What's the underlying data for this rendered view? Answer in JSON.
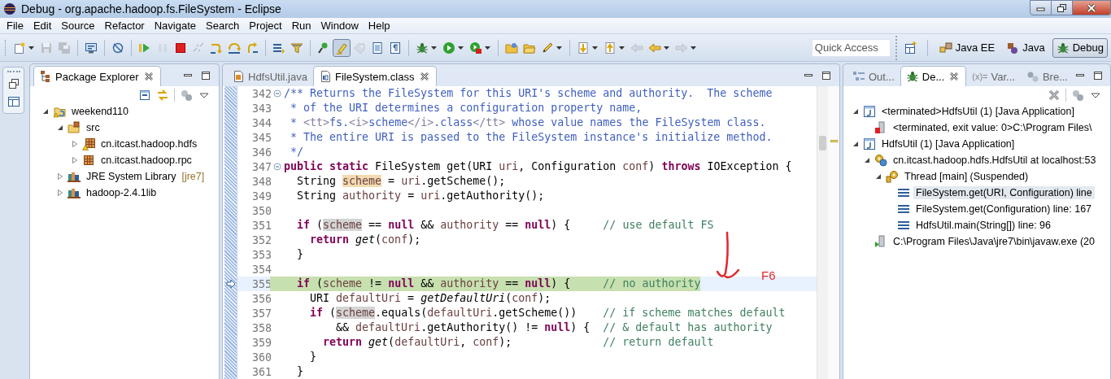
{
  "window": {
    "title": "Debug - org.apache.hadoop.fs.FileSystem - Eclipse"
  },
  "menu": [
    "File",
    "Edit",
    "Source",
    "Refactor",
    "Navigate",
    "Search",
    "Project",
    "Run",
    "Window",
    "Help"
  ],
  "toolbar": [
    [
      {
        "kind": "new",
        "dropdown": true,
        "disabled": false,
        "pressed": false
      },
      {
        "kind": "save",
        "dropdown": false,
        "disabled": true,
        "pressed": false
      },
      {
        "kind": "save-all",
        "dropdown": false,
        "disabled": true,
        "pressed": false
      }
    ],
    [
      {
        "kind": "monitor",
        "dropdown": false,
        "disabled": false,
        "pressed": false
      }
    ],
    [
      {
        "kind": "skip",
        "dropdown": false,
        "disabled": false,
        "pressed": false
      }
    ],
    [
      {
        "kind": "resume",
        "dropdown": false,
        "disabled": false,
        "pressed": false
      },
      {
        "kind": "suspend",
        "dropdown": false,
        "disabled": true,
        "pressed": false
      },
      {
        "kind": "terminate",
        "dropdown": false,
        "disabled": false,
        "pressed": false
      },
      {
        "kind": "disconnect",
        "dropdown": false,
        "disabled": true,
        "pressed": false
      },
      {
        "kind": "step-into",
        "dropdown": false,
        "disabled": false,
        "pressed": false
      },
      {
        "kind": "step-over",
        "dropdown": false,
        "disabled": false,
        "pressed": false
      },
      {
        "kind": "step-return",
        "dropdown": false,
        "disabled": false,
        "pressed": false
      }
    ],
    [
      {
        "kind": "frames",
        "dropdown": false,
        "disabled": false,
        "pressed": false
      },
      {
        "kind": "filter",
        "dropdown": false,
        "disabled": false,
        "pressed": false
      }
    ],
    [
      {
        "kind": "pin",
        "dropdown": false,
        "disabled": false,
        "pressed": false
      },
      {
        "kind": "highlighter",
        "dropdown": false,
        "disabled": false,
        "pressed": true
      },
      {
        "kind": "tag",
        "dropdown": false,
        "disabled": true,
        "pressed": false
      },
      {
        "kind": "block",
        "dropdown": false,
        "disabled": false,
        "pressed": false
      },
      {
        "kind": "pilcrow",
        "dropdown": false,
        "disabled": false,
        "pressed": false
      }
    ],
    [
      {
        "kind": "debug",
        "dropdown": true,
        "disabled": false,
        "pressed": false
      },
      {
        "kind": "run",
        "dropdown": true,
        "disabled": false,
        "pressed": false
      },
      {
        "kind": "external",
        "dropdown": true,
        "disabled": false,
        "pressed": false
      }
    ],
    [
      {
        "kind": "folder-gear",
        "dropdown": false,
        "disabled": false,
        "pressed": false
      },
      {
        "kind": "folder",
        "dropdown": false,
        "disabled": false,
        "pressed": false
      },
      {
        "kind": "pencil",
        "dropdown": true,
        "disabled": false,
        "pressed": false
      }
    ],
    [
      {
        "kind": "down-annotation",
        "dropdown": true,
        "disabled": false,
        "pressed": false
      },
      {
        "kind": "up-annotation",
        "dropdown": true,
        "disabled": false,
        "pressed": false
      },
      {
        "kind": "back",
        "dropdown": false,
        "disabled": true,
        "pressed": false
      },
      {
        "kind": "back",
        "dropdown": true,
        "disabled": false,
        "pressed": false
      },
      {
        "kind": "forward",
        "dropdown": true,
        "disabled": true,
        "pressed": false
      }
    ]
  ],
  "quick_access": {
    "placeholder": "Quick Access"
  },
  "perspectives": [
    {
      "label": "Java EE",
      "kind": "javaee",
      "selected": false
    },
    {
      "label": "Java",
      "kind": "java",
      "selected": false
    },
    {
      "label": "Debug",
      "kind": "debug",
      "selected": true
    }
  ],
  "package_explorer": {
    "tabs": [
      {
        "label": "Package Explorer",
        "kind": "package-explorer",
        "selected": true,
        "closable": true
      }
    ],
    "tree": [
      {
        "label": "weekend110",
        "kind": "project",
        "expandable": true,
        "expanded": true,
        "children": [
          {
            "label": "src",
            "kind": "srcfolder",
            "expandable": true,
            "expanded": true,
            "children": [
              {
                "label": "cn.itcast.hadoop.hdfs",
                "kind": "package-warn",
                "expandable": true,
                "expanded": false
              },
              {
                "label": "cn.itcast.hadoop.rpc",
                "kind": "package",
                "expandable": true,
                "expanded": false
              }
            ]
          },
          {
            "label": "JRE System Library",
            "suffix": "[jre7]",
            "kind": "library",
            "expandable": true,
            "expanded": false
          },
          {
            "label": "hadoop-2.4.1lib",
            "kind": "library",
            "expandable": true,
            "expanded": false
          }
        ]
      }
    ]
  },
  "editor": {
    "tabs": [
      {
        "label": "HdfsUtil.java",
        "kind": "java-file",
        "selected": false,
        "closable": false
      },
      {
        "label": "FileSystem.class",
        "kind": "class-file",
        "selected": true,
        "closable": true
      }
    ],
    "lines": [
      {
        "number": "342",
        "foldable": true,
        "current": false,
        "tokens": [
          {
            "kind": "doc",
            "text": "/** Returns the FileSystem for this URI's scheme and authority.  The scheme"
          }
        ]
      },
      {
        "number": "343",
        "foldable": false,
        "current": false,
        "tokens": [
          {
            "kind": "doc",
            "text": " * of the URI determines a configuration property name,"
          }
        ]
      },
      {
        "number": "344",
        "foldable": false,
        "current": false,
        "tokens": [
          {
            "kind": "doc",
            "text": " * "
          },
          {
            "kind": "tag",
            "text": "<tt>"
          },
          {
            "kind": "doc",
            "text": "fs."
          },
          {
            "kind": "tag",
            "text": "<i>"
          },
          {
            "kind": "doc",
            "text": "scheme"
          },
          {
            "kind": "tag",
            "text": "</i>"
          },
          {
            "kind": "doc",
            "text": ".class"
          },
          {
            "kind": "tag",
            "text": "</tt>"
          },
          {
            "kind": "doc",
            "text": " whose value names the FileSystem class."
          }
        ]
      },
      {
        "number": "345",
        "foldable": false,
        "current": false,
        "tokens": [
          {
            "kind": "doc",
            "text": " * The entire URI is passed to the FileSystem instance's initialize method."
          }
        ]
      },
      {
        "number": "346",
        "foldable": false,
        "current": false,
        "tokens": [
          {
            "kind": "doc",
            "text": " */"
          }
        ]
      },
      {
        "number": "347",
        "foldable": true,
        "current": false,
        "tokens": [
          {
            "kind": "keyword",
            "text": "public "
          },
          {
            "kind": "keyword",
            "text": "static"
          },
          {
            "kind": "plain",
            "text": " FileSystem get(URI "
          },
          {
            "kind": "variable",
            "text": "uri"
          },
          {
            "kind": "plain",
            "text": ", Configuration "
          },
          {
            "kind": "variable",
            "text": "conf"
          },
          {
            "kind": "plain",
            "text": ") "
          },
          {
            "kind": "keyword",
            "text": "throws"
          },
          {
            "kind": "plain",
            "text": " IOException {"
          }
        ]
      },
      {
        "number": "348",
        "foldable": false,
        "current": false,
        "tokens": [
          {
            "kind": "plain",
            "text": "  String "
          },
          {
            "kind": "write-occurrence",
            "text": "scheme"
          },
          {
            "kind": "plain",
            "text": " = "
          },
          {
            "kind": "variable",
            "text": "uri"
          },
          {
            "kind": "plain",
            "text": ".getScheme();"
          }
        ]
      },
      {
        "number": "349",
        "foldable": false,
        "current": false,
        "tokens": [
          {
            "kind": "plain",
            "text": "  String "
          },
          {
            "kind": "variable",
            "text": "authority"
          },
          {
            "kind": "plain",
            "text": " = "
          },
          {
            "kind": "variable",
            "text": "uri"
          },
          {
            "kind": "plain",
            "text": ".getAuthority();"
          }
        ]
      },
      {
        "number": "350",
        "foldable": false,
        "current": false
      },
      {
        "number": "351",
        "foldable": false,
        "current": false,
        "tokens": [
          {
            "kind": "keyword",
            "text": "  if"
          },
          {
            "kind": "plain",
            "text": " ("
          },
          {
            "kind": "occurrence",
            "text": "scheme"
          },
          {
            "kind": "plain",
            "text": " == "
          },
          {
            "kind": "keyword",
            "text": "null"
          },
          {
            "kind": "plain",
            "text": " && "
          },
          {
            "kind": "variable",
            "text": "authority"
          },
          {
            "kind": "plain",
            "text": " == "
          },
          {
            "kind": "keyword",
            "text": "null"
          },
          {
            "kind": "plain",
            "text": ") {     "
          },
          {
            "kind": "comment",
            "text": "// use default FS"
          }
        ]
      },
      {
        "number": "352",
        "foldable": false,
        "current": false,
        "tokens": [
          {
            "kind": "keyword",
            "text": "    return "
          },
          {
            "kind": "static-call",
            "text": "get"
          },
          {
            "kind": "plain",
            "text": "("
          },
          {
            "kind": "variable",
            "text": "conf"
          },
          {
            "kind": "plain",
            "text": ");"
          }
        ]
      },
      {
        "number": "353",
        "foldable": false,
        "current": false,
        "tokens": [
          {
            "kind": "plain",
            "text": "  }"
          }
        ]
      },
      {
        "number": "354",
        "foldable": false,
        "current": false
      },
      {
        "number": "355",
        "foldable": false,
        "current": true,
        "tokens": [
          {
            "kind": "keyword",
            "text": "  if"
          },
          {
            "kind": "plain",
            "text": " ("
          },
          {
            "kind": "variable",
            "text": "scheme"
          },
          {
            "kind": "plain",
            "text": " != "
          },
          {
            "kind": "keyword",
            "text": "null"
          },
          {
            "kind": "plain",
            "text": " && "
          },
          {
            "kind": "variable",
            "text": "authority"
          },
          {
            "kind": "plain",
            "text": " == "
          },
          {
            "kind": "keyword",
            "text": "null"
          },
          {
            "kind": "plain",
            "text": ") {     "
          },
          {
            "kind": "comment",
            "text": "// no authority"
          }
        ]
      },
      {
        "number": "356",
        "foldable": false,
        "current": false,
        "tokens": [
          {
            "kind": "plain",
            "text": "    URI "
          },
          {
            "kind": "variable",
            "text": "defaultUri"
          },
          {
            "kind": "plain",
            "text": " = "
          },
          {
            "kind": "static-call",
            "text": "getDefaultUri"
          },
          {
            "kind": "plain",
            "text": "("
          },
          {
            "kind": "variable",
            "text": "conf"
          },
          {
            "kind": "plain",
            "text": ");"
          }
        ]
      },
      {
        "number": "357",
        "foldable": false,
        "current": false,
        "tokens": [
          {
            "kind": "keyword",
            "text": "    if"
          },
          {
            "kind": "plain",
            "text": " ("
          },
          {
            "kind": "occurrence",
            "text": "scheme"
          },
          {
            "kind": "plain",
            "text": ".equals("
          },
          {
            "kind": "variable",
            "text": "defaultUri"
          },
          {
            "kind": "plain",
            "text": ".getScheme())    "
          },
          {
            "kind": "comment",
            "text": "// if scheme matches default"
          }
        ]
      },
      {
        "number": "358",
        "foldable": false,
        "current": false,
        "tokens": [
          {
            "kind": "plain",
            "text": "        && "
          },
          {
            "kind": "variable",
            "text": "defaultUri"
          },
          {
            "kind": "plain",
            "text": ".getAuthority() != "
          },
          {
            "kind": "keyword",
            "text": "null"
          },
          {
            "kind": "plain",
            "text": ") {  "
          },
          {
            "kind": "comment",
            "text": "// & default has authority"
          }
        ]
      },
      {
        "number": "359",
        "foldable": false,
        "current": false,
        "tokens": [
          {
            "kind": "keyword",
            "text": "      return "
          },
          {
            "kind": "static-call",
            "text": "get"
          },
          {
            "kind": "plain",
            "text": "("
          },
          {
            "kind": "variable",
            "text": "defaultUri"
          },
          {
            "kind": "plain",
            "text": ", "
          },
          {
            "kind": "variable",
            "text": "conf"
          },
          {
            "kind": "plain",
            "text": ");              "
          },
          {
            "kind": "comment",
            "text": "// return default"
          }
        ]
      },
      {
        "number": "360",
        "foldable": false,
        "current": false,
        "tokens": [
          {
            "kind": "plain",
            "text": "    }"
          }
        ]
      },
      {
        "number": "361",
        "foldable": false,
        "current": false,
        "tokens": [
          {
            "kind": "plain",
            "text": "  }"
          }
        ]
      }
    ]
  },
  "annotation": {
    "text": "F6"
  },
  "debug_panel": {
    "tabs": [
      {
        "label": "Out...",
        "kind": "outline",
        "selected": false,
        "closable": false
      },
      {
        "label": "De...",
        "kind": "debug",
        "selected": true,
        "closable": true
      },
      {
        "label": "Var...",
        "glyph": "(x)=",
        "selected": false,
        "closable": false
      },
      {
        "label": "Bre...",
        "kind": "breakpoints",
        "selected": false,
        "closable": false
      }
    ],
    "tree": [
      {
        "label": "<terminated>HdfsUtil (1) [Java Application]",
        "kind": "launch",
        "expandable": true,
        "expanded": true,
        "selected": false,
        "children": [
          {
            "label": "<terminated, exit value: 0>C:\\Program Files\\",
            "kind": "process-terminated",
            "expandable": false,
            "selected": false
          }
        ]
      },
      {
        "label": "HdfsUtil (1) [Java Application]",
        "kind": "launch",
        "expandable": true,
        "expanded": true,
        "selected": false,
        "children": [
          {
            "label": "cn.itcast.hadoop.hdfs.HdfsUtil at localhost:53",
            "kind": "target",
            "expandable": true,
            "expanded": true,
            "selected": false,
            "children": [
              {
                "label": "Thread [main] (Suspended)",
                "kind": "thread",
                "expandable": true,
                "expanded": true,
                "selected": false,
                "children": [
                  {
                    "label": "FileSystem.get(URI, Configuration) line",
                    "kind": "frame",
                    "expandable": false,
                    "selected": true
                  },
                  {
                    "label": "FileSystem.get(Configuration) line: 167",
                    "kind": "frame",
                    "expandable": false,
                    "selected": false
                  },
                  {
                    "label": "HdfsUtil.main(String[]) line: 96",
                    "kind": "frame",
                    "expandable": false,
                    "selected": false
                  }
                ]
              }
            ]
          },
          {
            "label": "C:\\Program Files\\Java\\jre7\\bin\\javaw.exe (20",
            "kind": "process",
            "expandable": false,
            "selected": false
          }
        ]
      }
    ]
  }
}
